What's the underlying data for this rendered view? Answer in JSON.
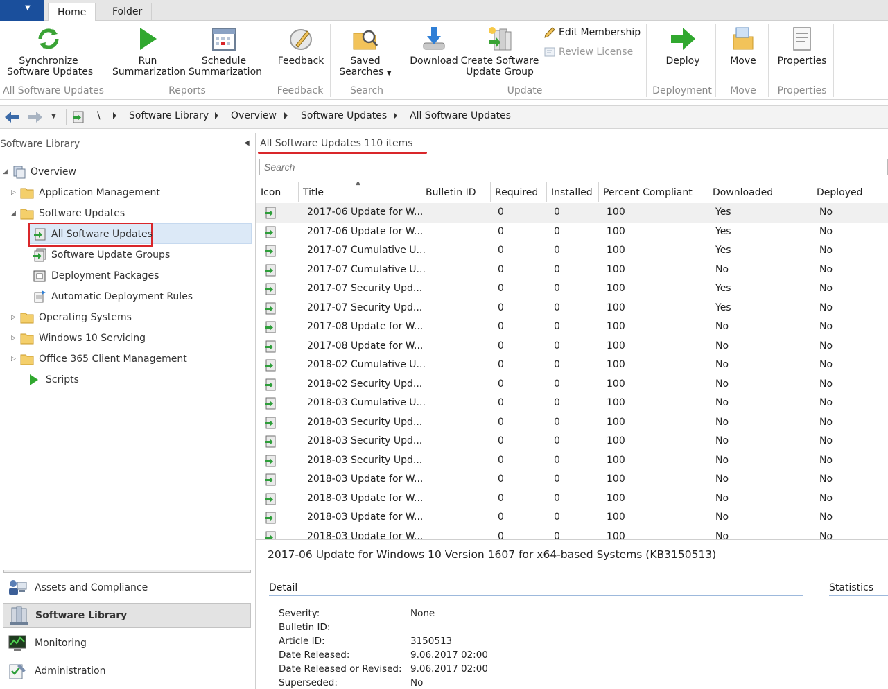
{
  "ribbon_tabs": {
    "home": "Home",
    "folder": "Folder"
  },
  "ribbon": {
    "sync": [
      "Synchronize",
      "Software Updates"
    ],
    "run_summary": [
      "Run",
      "Summarization"
    ],
    "schedule_summary": [
      "Schedule",
      "Summarization"
    ],
    "feedback": "Feedback",
    "saved_searches": [
      "Saved",
      "Searches"
    ],
    "download": "Download",
    "create_group": [
      "Create Software",
      "Update Group"
    ],
    "edit_membership": "Edit Membership",
    "review_license": "Review License",
    "deploy": "Deploy",
    "move": "Move",
    "properties": "Properties",
    "groups": {
      "all_updates": "All Software Updates",
      "reports": "Reports",
      "feedback": "Feedback",
      "search": "Search",
      "update": "Update",
      "deployment": "Deployment",
      "move": "Move",
      "properties": "Properties"
    }
  },
  "breadcrumb": {
    "root": "\\",
    "items": [
      "Software Library",
      "Overview",
      "Software Updates",
      "All Software Updates"
    ]
  },
  "left_pane": {
    "title": "Software Library",
    "tree": {
      "overview": "Overview",
      "app_mgmt": "Application Management",
      "software_updates": "Software Updates",
      "all_updates": "All Software Updates",
      "update_groups": "Software Update Groups",
      "deploy_packages": "Deployment Packages",
      "adr": "Automatic Deployment Rules",
      "os": "Operating Systems",
      "win10": "Windows 10 Servicing",
      "o365": "Office 365 Client Management",
      "scripts": "Scripts"
    },
    "workspaces": {
      "assets": "Assets and Compliance",
      "library": "Software Library",
      "monitoring": "Monitoring",
      "admin": "Administration"
    }
  },
  "main": {
    "list_title": "All Software Updates",
    "item_count": "110 items",
    "search_placeholder": "Search",
    "columns": {
      "icon": "Icon",
      "title": "Title",
      "bulletin": "Bulletin ID",
      "required": "Required",
      "installed": "Installed",
      "percent": "Percent Compliant",
      "downloaded": "Downloaded",
      "deployed": "Deployed"
    },
    "rows": [
      {
        "title": "2017-06 Update for W...",
        "required": "0",
        "installed": "0",
        "percent": "100",
        "downloaded": "Yes",
        "deployed": "No"
      },
      {
        "title": "2017-06 Update for W...",
        "required": "0",
        "installed": "0",
        "percent": "100",
        "downloaded": "Yes",
        "deployed": "No"
      },
      {
        "title": "2017-07 Cumulative U...",
        "required": "0",
        "installed": "0",
        "percent": "100",
        "downloaded": "Yes",
        "deployed": "No"
      },
      {
        "title": "2017-07 Cumulative U...",
        "required": "0",
        "installed": "0",
        "percent": "100",
        "downloaded": "No",
        "deployed": "No"
      },
      {
        "title": "2017-07 Security Upd...",
        "required": "0",
        "installed": "0",
        "percent": "100",
        "downloaded": "Yes",
        "deployed": "No"
      },
      {
        "title": "2017-07 Security Upd...",
        "required": "0",
        "installed": "0",
        "percent": "100",
        "downloaded": "Yes",
        "deployed": "No"
      },
      {
        "title": "2017-08 Update for W...",
        "required": "0",
        "installed": "0",
        "percent": "100",
        "downloaded": "No",
        "deployed": "No"
      },
      {
        "title": "2017-08 Update for W...",
        "required": "0",
        "installed": "0",
        "percent": "100",
        "downloaded": "No",
        "deployed": "No"
      },
      {
        "title": "2018-02 Cumulative U...",
        "required": "0",
        "installed": "0",
        "percent": "100",
        "downloaded": "No",
        "deployed": "No"
      },
      {
        "title": "2018-02 Security Upd...",
        "required": "0",
        "installed": "0",
        "percent": "100",
        "downloaded": "No",
        "deployed": "No"
      },
      {
        "title": "2018-03 Cumulative U...",
        "required": "0",
        "installed": "0",
        "percent": "100",
        "downloaded": "No",
        "deployed": "No"
      },
      {
        "title": "2018-03 Security Upd...",
        "required": "0",
        "installed": "0",
        "percent": "100",
        "downloaded": "No",
        "deployed": "No"
      },
      {
        "title": "2018-03 Security Upd...",
        "required": "0",
        "installed": "0",
        "percent": "100",
        "downloaded": "No",
        "deployed": "No"
      },
      {
        "title": "2018-03 Security Upd...",
        "required": "0",
        "installed": "0",
        "percent": "100",
        "downloaded": "No",
        "deployed": "No"
      },
      {
        "title": "2018-03 Update for W...",
        "required": "0",
        "installed": "0",
        "percent": "100",
        "downloaded": "No",
        "deployed": "No"
      },
      {
        "title": "2018-03 Update for W...",
        "required": "0",
        "installed": "0",
        "percent": "100",
        "downloaded": "No",
        "deployed": "No"
      },
      {
        "title": "2018-03 Update for W...",
        "required": "0",
        "installed": "0",
        "percent": "100",
        "downloaded": "No",
        "deployed": "No"
      },
      {
        "title": "2018-03 Update for W...",
        "required": "0",
        "installed": "0",
        "percent": "100",
        "downloaded": "No",
        "deployed": "No"
      }
    ]
  },
  "preview": {
    "title": "2017-06 Update for Windows 10 Version 1607 for x64-based Systems (KB3150513)",
    "detail_tab": "Detail",
    "stats_tab": "Statistics",
    "fields": [
      {
        "label": "Severity:",
        "value": "None"
      },
      {
        "label": "Bulletin ID:",
        "value": ""
      },
      {
        "label": "Article ID:",
        "value": "3150513"
      },
      {
        "label": "Date Released:",
        "value": "9.06.2017 02:00"
      },
      {
        "label": "Date Released or Revised:",
        "value": "9.06.2017 02:00"
      },
      {
        "label": "Superseded:",
        "value": "No"
      }
    ]
  },
  "colors": {
    "accent_red": "#d9262a",
    "app_blue": "#1a4f9c",
    "selection": "#dce9f7",
    "update_icon_green": "#2e9e3a"
  }
}
